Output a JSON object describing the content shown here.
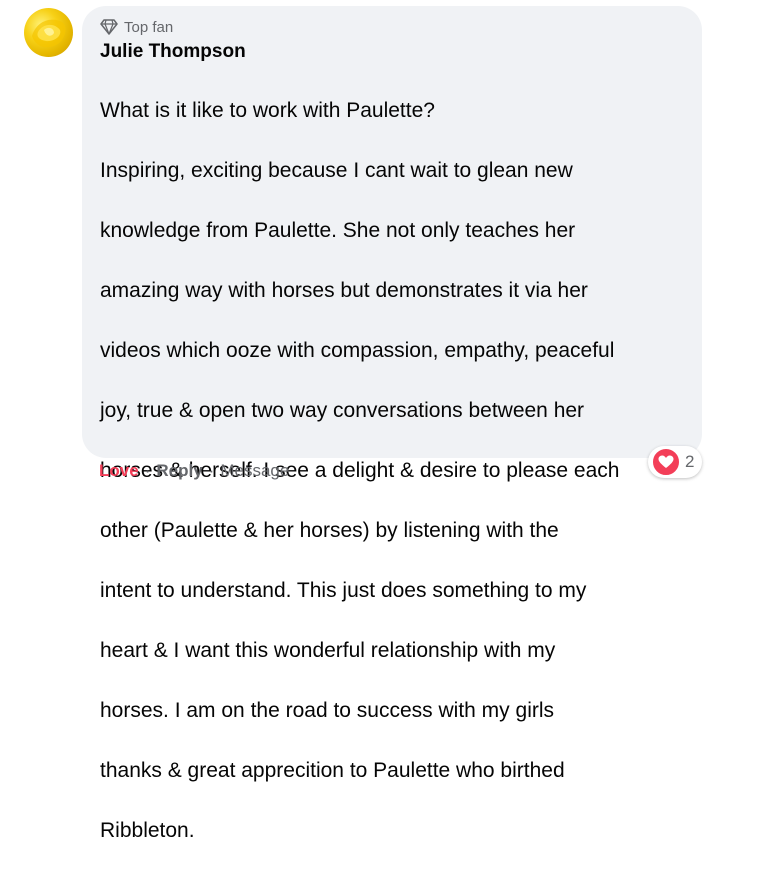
{
  "comment": {
    "badge": "Top fan",
    "badge_icon": "diamond-icon",
    "author": "Julie Thompson",
    "lines": [
      "What is it like to work with Paulette?",
      "Inspiring, exciting because I cant wait to glean new",
      "knowledge from Paulette. She not only teaches her",
      "amazing way with horses but demonstrates it via her",
      "videos which ooze with compassion, empathy, peaceful",
      "joy, true & open two way conversations between her",
      "horses & herself. I see a delight & desire to please each",
      "other (Paulette & her horses) by listening with the",
      "intent to understand. This just does something to my",
      "heart & I want this wonderful relationship with my",
      "horses. I am on the road to success with my girls",
      "thanks & great apprecition to Paulette who birthed",
      "Ribbleton."
    ]
  },
  "actions": {
    "love_label": "Love",
    "separator": "·",
    "reply_label": "Reply",
    "message_label": "Message"
  },
  "reactions": {
    "icon": "heart-icon",
    "count": "2"
  },
  "colors": {
    "bubble_bg": "#f0f2f5",
    "love_red": "#f33e58",
    "meta_gray": "#65676b",
    "text": "#050505"
  }
}
